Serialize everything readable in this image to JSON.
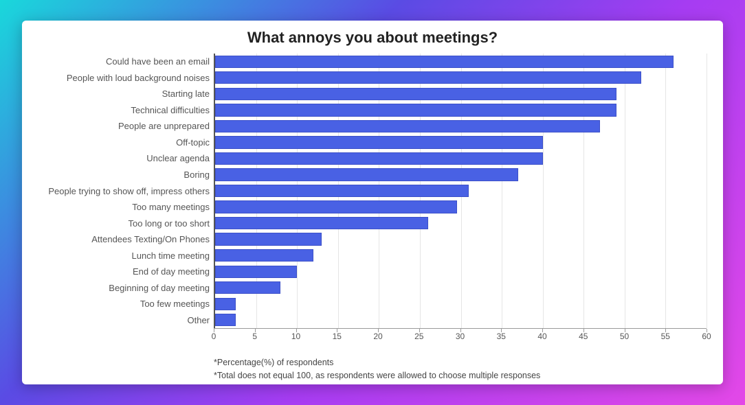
{
  "chart_data": {
    "type": "bar",
    "orientation": "horizontal",
    "title": "What annoys you about meetings?",
    "categories": [
      "Could have been an email",
      "People with loud background noises",
      "Starting late",
      "Technical difficulties",
      "People are unprepared",
      "Off-topic",
      "Unclear agenda",
      "Boring",
      "People trying to show off, impress others",
      "Too many meetings",
      "Too long or too short",
      "Attendees Texting/On Phones",
      "Lunch time meeting",
      "End of day meeting",
      "Beginning of day meeting",
      "Too few meetings",
      "Other"
    ],
    "values": [
      56,
      52,
      49,
      49,
      47,
      40,
      40,
      37,
      31,
      29.5,
      26,
      13,
      12,
      10,
      8,
      2.5,
      2.5
    ],
    "xlabel": "",
    "ylabel": "",
    "xlim": [
      0,
      60
    ],
    "x_ticks": [
      0,
      5,
      10,
      15,
      20,
      25,
      30,
      35,
      40,
      45,
      50,
      55,
      60
    ],
    "bar_color": "#4961e4",
    "footnotes": [
      "*Percentage(%) of respondents",
      "*Total does not equal 100, as respondents were allowed to choose multiple responses"
    ]
  }
}
